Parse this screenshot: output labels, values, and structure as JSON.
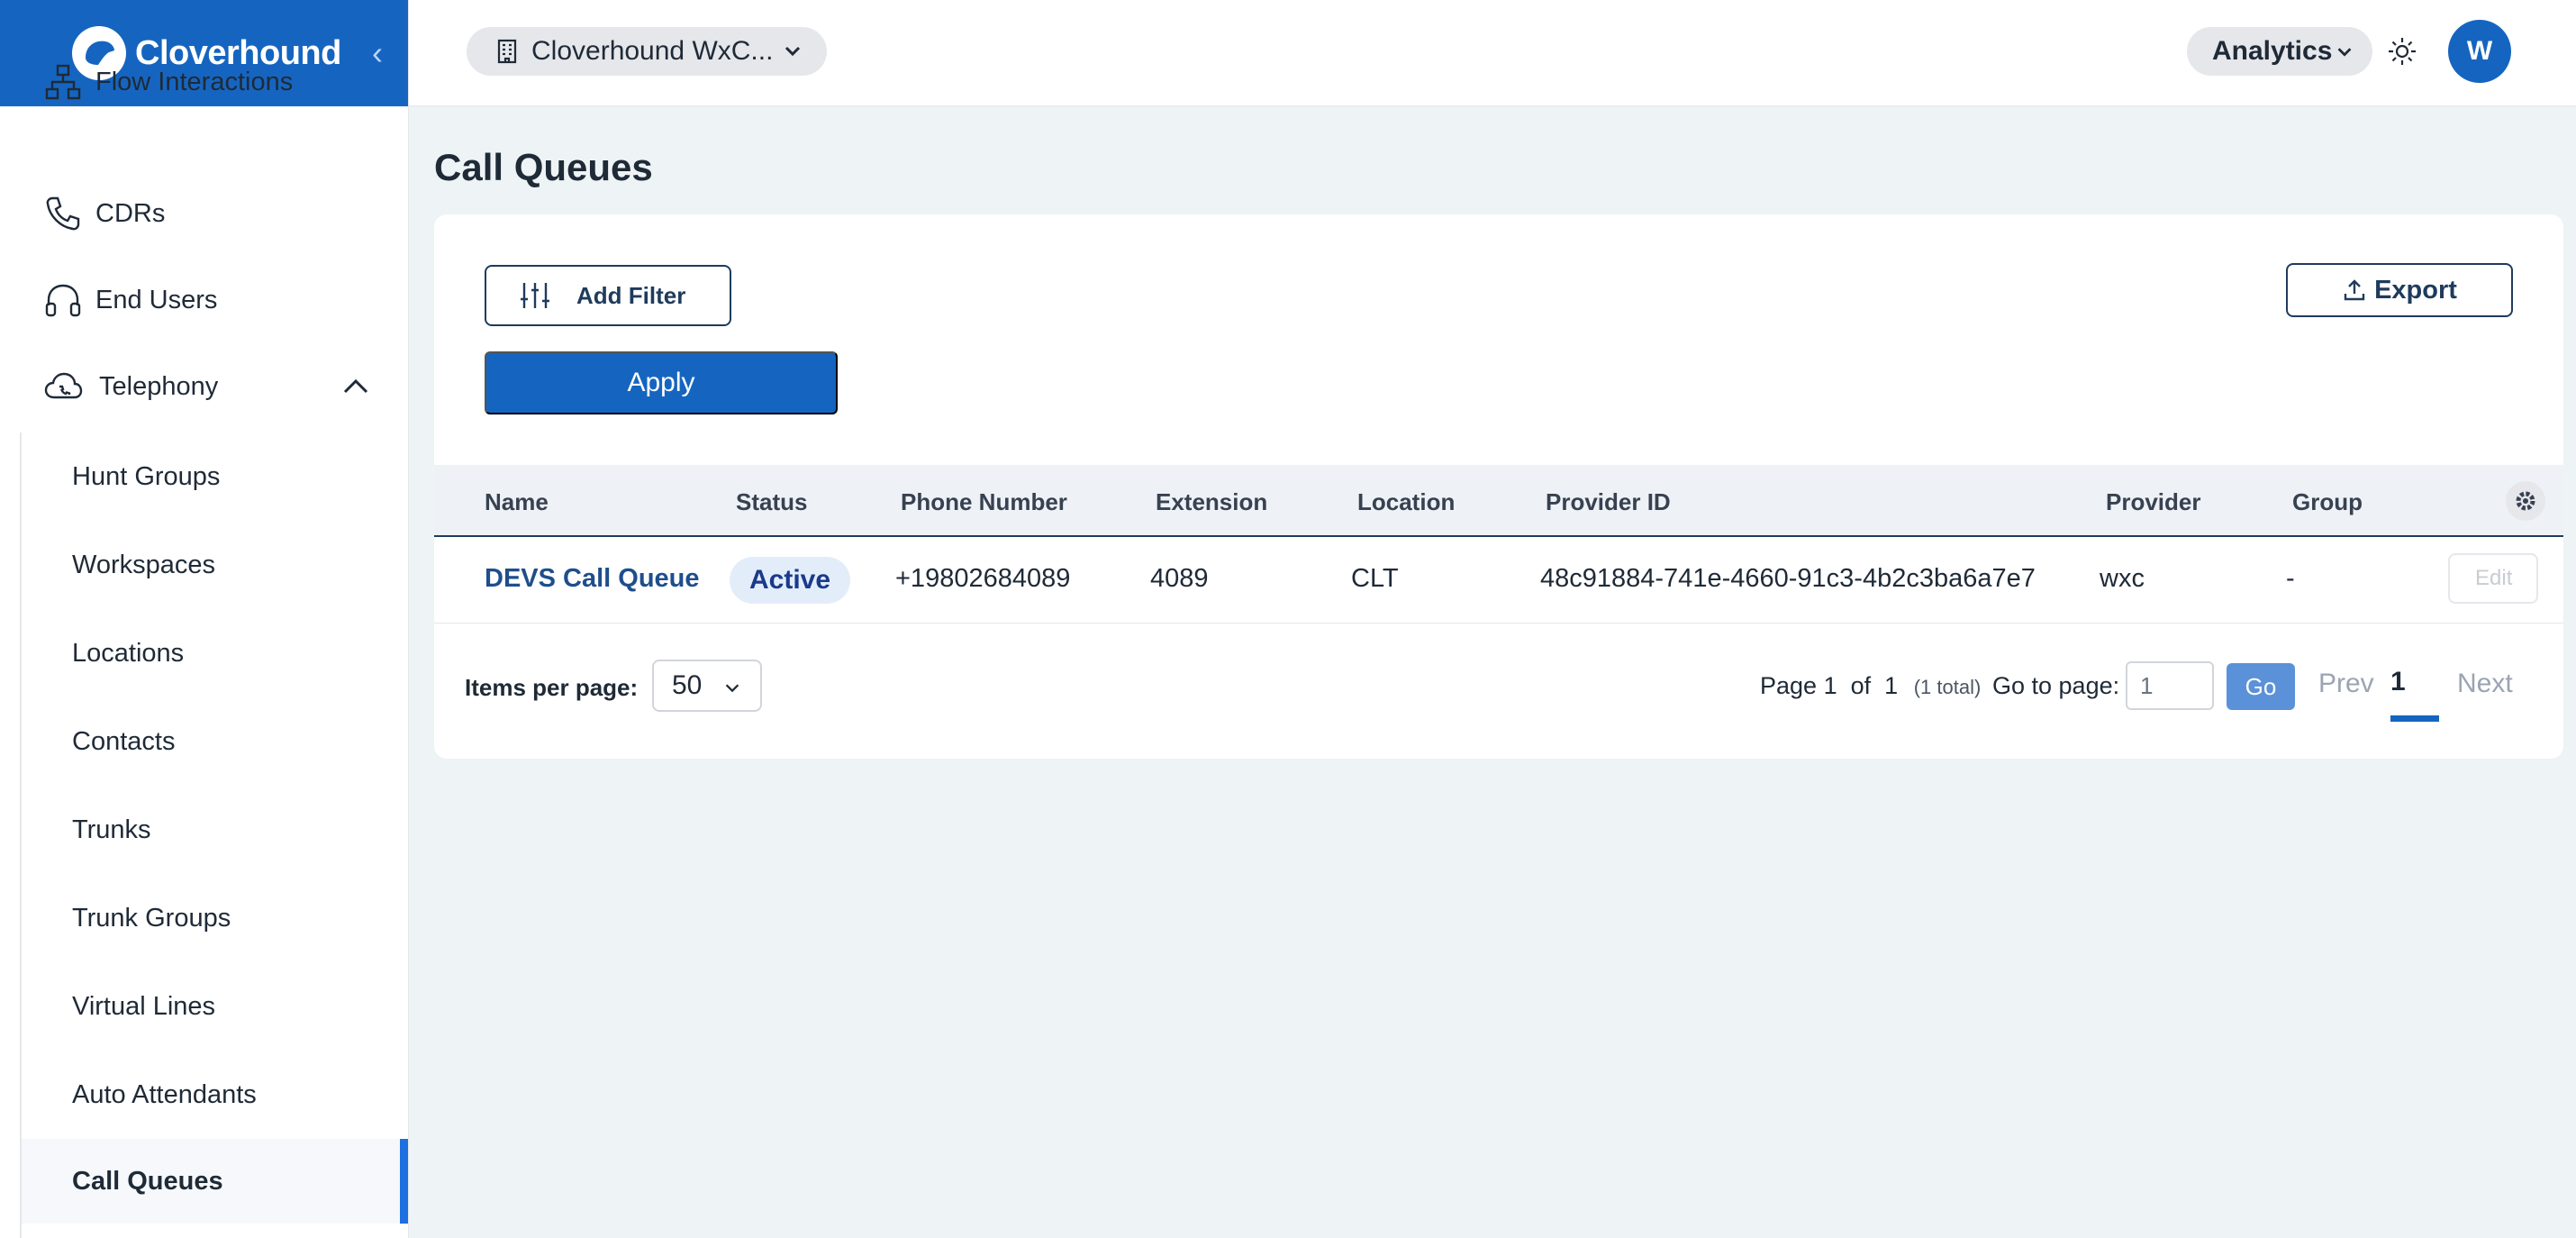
{
  "brand": {
    "name": "Cloverhound"
  },
  "sidebar": {
    "items": [
      {
        "label": "Flow Interactions",
        "icon": "flow-icon"
      },
      {
        "label": "CDRs",
        "icon": "phone-icon"
      },
      {
        "label": "End Users",
        "icon": "headset-icon"
      },
      {
        "label": "Telephony",
        "icon": "cloud-icon",
        "expanded": true
      }
    ],
    "sub_items": [
      {
        "label": "Hunt Groups"
      },
      {
        "label": "Workspaces"
      },
      {
        "label": "Locations"
      },
      {
        "label": "Contacts"
      },
      {
        "label": "Trunks"
      },
      {
        "label": "Trunk Groups"
      },
      {
        "label": "Virtual Lines"
      },
      {
        "label": "Auto Attendants"
      },
      {
        "label": "Call Queues",
        "active": true
      }
    ]
  },
  "topbar": {
    "org_name": "Cloverhound WxC...",
    "analytics_label": "Analytics",
    "avatar_initial": "W"
  },
  "main": {
    "title": "Call Queues",
    "add_filter_label": "Add Filter",
    "apply_label": "Apply",
    "export_label": "Export",
    "table": {
      "columns": [
        "Name",
        "Status",
        "Phone Number",
        "Extension",
        "Location",
        "Provider ID",
        "Provider",
        "Group"
      ],
      "rows": [
        {
          "name": "DEVS Call Queue",
          "status": "Active",
          "phone": "+19802684089",
          "extension": "4089",
          "location": "CLT",
          "provider_id": "48c91884-741e-4660-91c3-4b2c3ba6a7e7",
          "provider": "wxc",
          "group": "-",
          "action": "Edit"
        }
      ]
    },
    "pagination": {
      "items_per_page_label": "Items per page:",
      "items_per_page": "50",
      "page_label": "Page",
      "page_current": "1",
      "of_label": "of",
      "page_total": "1",
      "total_note": "(1 total)",
      "goto_label": "Go to page:",
      "goto_value": "1",
      "go_label": "Go",
      "prev_label": "Prev",
      "current_page": "1",
      "next_label": "Next"
    }
  },
  "colors": {
    "brand": "#1565c0",
    "accent": "#1e6fe0",
    "link": "#1e4e8c",
    "badge_bg": "#e3edfa"
  }
}
